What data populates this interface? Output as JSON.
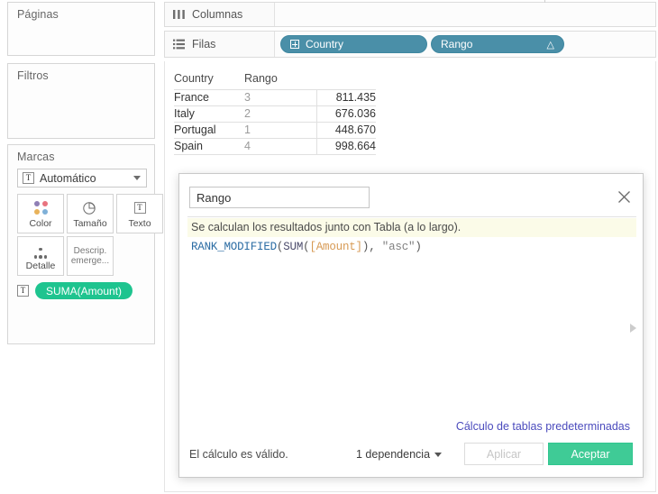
{
  "sidebar": {
    "pages_label": "Páginas",
    "filters_label": "Filtros",
    "marks_label": "Marcas",
    "marks_type": "Automático",
    "marks_type_icon": "text-mark-icon",
    "buttons": [
      {
        "label": "Color",
        "icon": "color-dots-icon"
      },
      {
        "label": "Tamaño",
        "icon": "size-circle-icon"
      },
      {
        "label": "Texto",
        "icon": "text-t-icon"
      },
      {
        "label": "Detalle",
        "icon": "detail-dots-icon"
      },
      {
        "label": "Descrip. emerge...",
        "icon": "tooltip-icon"
      }
    ],
    "mark_pill": "SUMA(Amount)",
    "mark_pill_icon": "text-t-icon",
    "color_dots": [
      "#8f7fb5",
      "#e8737f",
      "#e8b25a",
      "#7fb0d8"
    ]
  },
  "shelves": {
    "columns_label": "Columnas",
    "columns_icon": "columns-icon",
    "rows_label": "Filas",
    "rows_icon": "rows-icon",
    "rows_pills": [
      {
        "label": "Country",
        "icon": "hierarchy-plus-icon",
        "badge": ""
      },
      {
        "label": "Rango",
        "icon": "",
        "badge": "△"
      }
    ]
  },
  "table": {
    "headers": [
      "Country",
      "Rango",
      ""
    ],
    "rows": [
      {
        "country": "France",
        "rango": "3",
        "amount": "811.435"
      },
      {
        "country": "Italy",
        "rango": "2",
        "amount": "676.036"
      },
      {
        "country": "Portugal",
        "rango": "1",
        "amount": "448.670"
      },
      {
        "country": "Spain",
        "rango": "4",
        "amount": "998.664"
      }
    ]
  },
  "dialog": {
    "name_value": "Rango",
    "name_placeholder": "Rango",
    "close_icon": "close-icon",
    "note": "Se calculan los resultados junto con Tabla (a lo largo).",
    "formula": {
      "function": "RANK_MODIFIED",
      "open_paren": "(",
      "agg": "SUM",
      "agg_open": "(",
      "field": "[Amount]",
      "agg_close": ")",
      "comma": ", ",
      "string_arg": "\"asc\"",
      "close_paren": ")"
    },
    "expand_icon": "expand-right-arrow-icon",
    "default_calc_link": "Cálculo de tablas predeterminadas",
    "status": "El cálculo es válido.",
    "dependency": "1 dependencia",
    "apply_label": "Aplicar",
    "ok_label": "Aceptar"
  },
  "colors": {
    "pill_teal": "#4a8fa8",
    "pill_green": "#1ec48f",
    "ok_green": "#3fcb96",
    "link_purple": "#4b4bbd",
    "note_bg": "#fbfbe8",
    "fn_blue": "#2b6ca3",
    "field_orange": "#d79a54"
  }
}
